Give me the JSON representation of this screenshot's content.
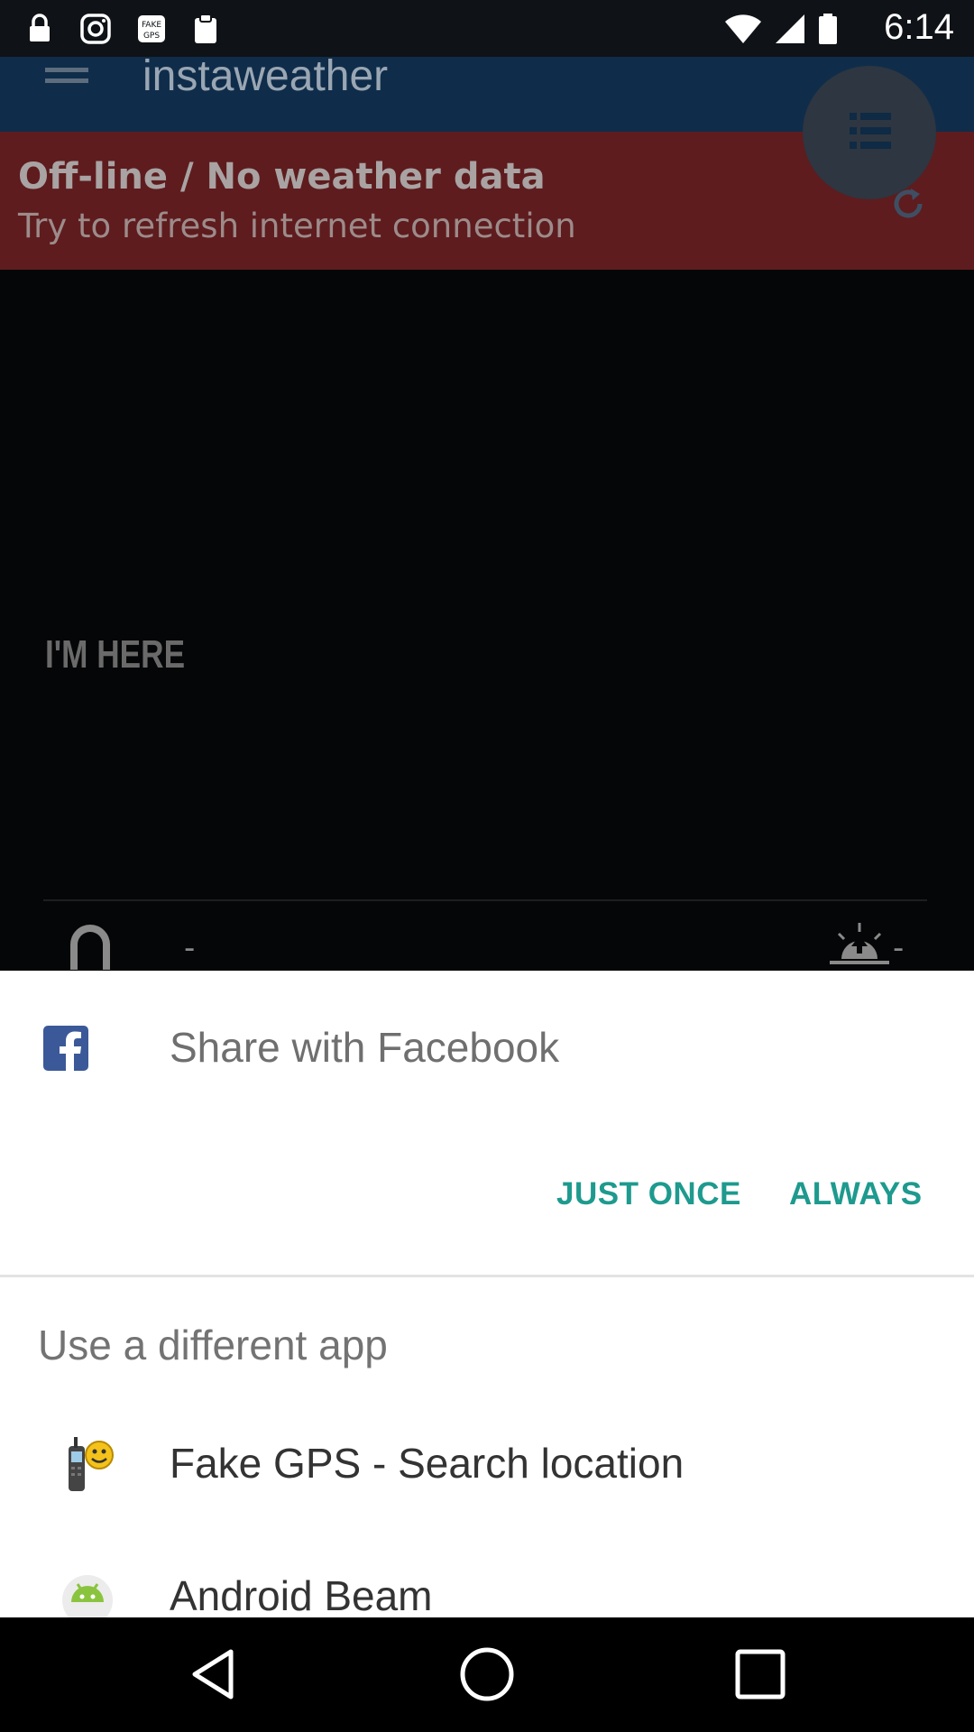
{
  "status_bar": {
    "time": "6:14",
    "icons": [
      "lock-icon",
      "instagram-icon",
      "fake-gps-notification-icon",
      "clipboard-icon",
      "wifi-icon",
      "signal-icon",
      "battery-icon"
    ]
  },
  "app": {
    "title": "instaweather",
    "offline_title": "Off-line / No weather data",
    "offline_subtitle": "Try to refresh internet connection",
    "location_label": "I'M HERE",
    "left_value": "-",
    "right_value": "-"
  },
  "share_sheet": {
    "title": "Share with Facebook",
    "just_once": "JUST ONCE",
    "always": "ALWAYS",
    "different_app": "Use a different app",
    "apps": [
      {
        "label": "Fake GPS - Search location",
        "icon": "fake-gps-icon"
      },
      {
        "label": "Android Beam",
        "icon": "android-beam-icon"
      }
    ]
  },
  "colors": {
    "accent": "#1e9a8e",
    "facebook": "#3b5998",
    "offline_banner": "#5e1c1e",
    "toolbar": "#0f2d4a"
  },
  "nav_bar": {
    "buttons": [
      "back-icon",
      "home-icon",
      "recents-icon"
    ]
  }
}
